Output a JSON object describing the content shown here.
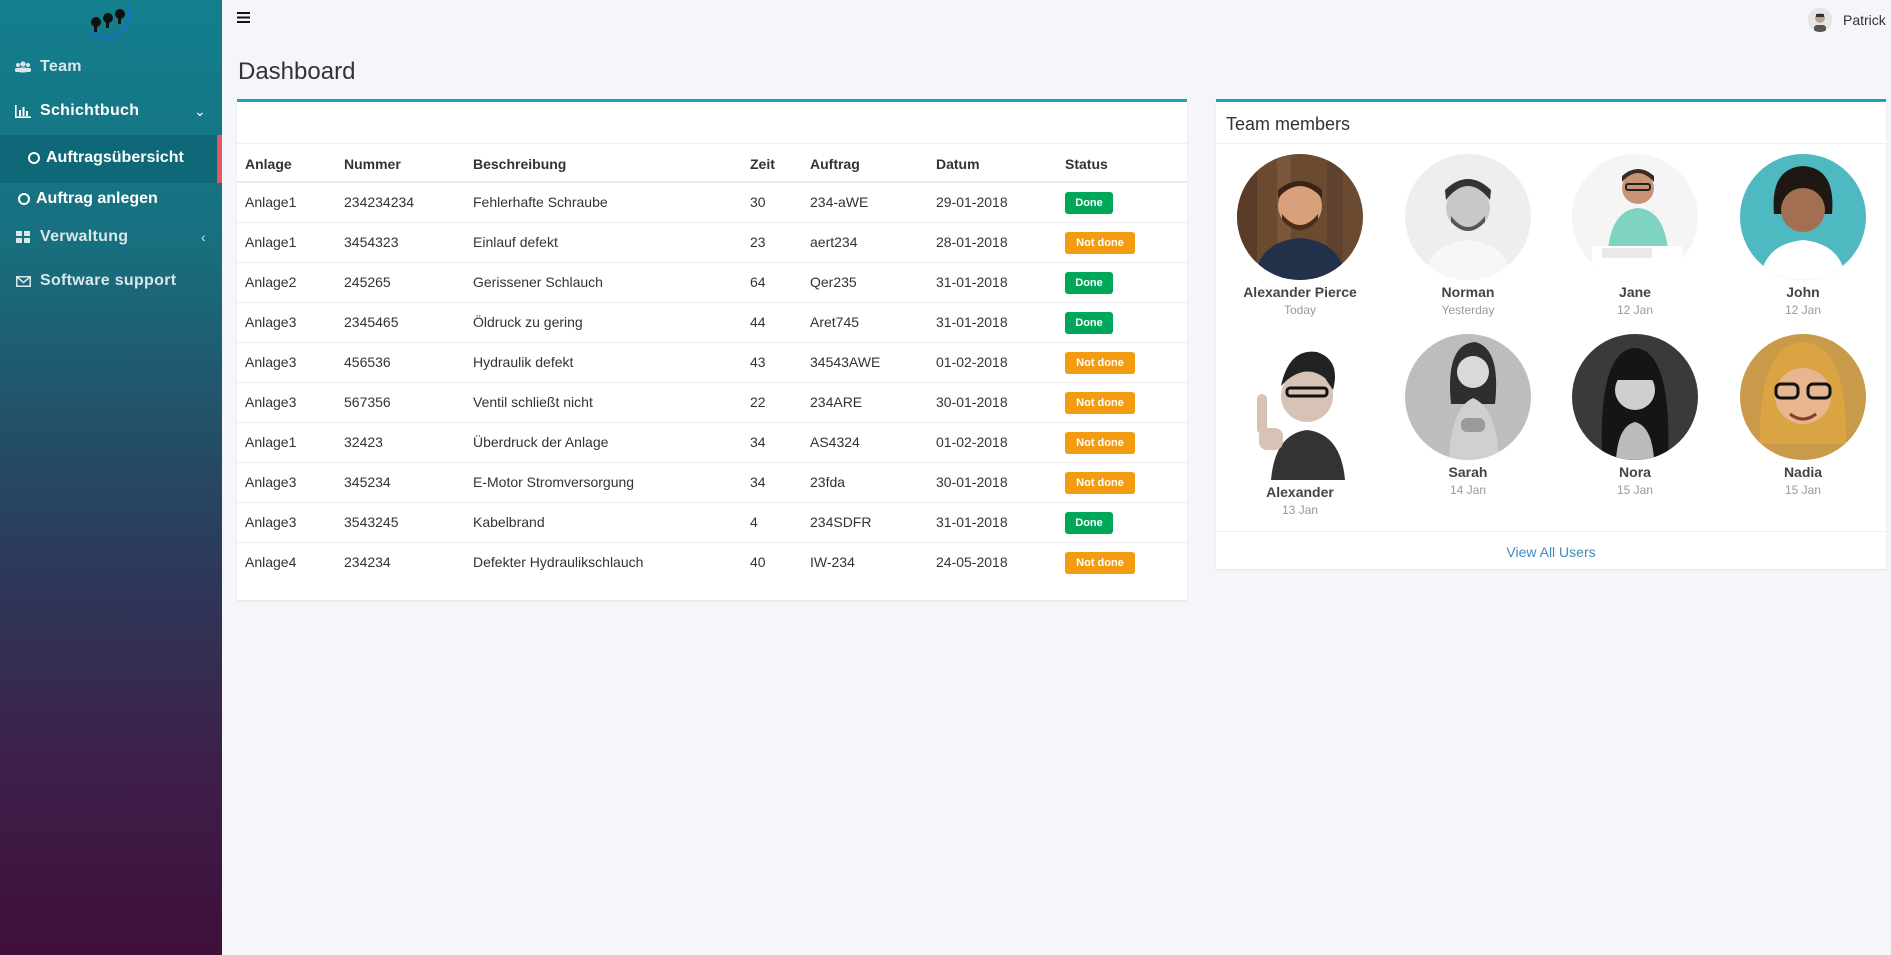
{
  "sidebar": {
    "items": [
      {
        "label": "Team",
        "icon": "users-icon"
      },
      {
        "label": "Schichtbuch",
        "icon": "bar-chart-icon"
      },
      {
        "label": "Auftragsübersicht",
        "icon": "circle-icon"
      },
      {
        "label": "Auftrag anlegen",
        "icon": "circle-icon"
      },
      {
        "label": "Verwaltung",
        "icon": "dashboard-icon"
      },
      {
        "label": "Software support",
        "icon": "envelope-icon"
      }
    ],
    "accent": "#e05a66"
  },
  "topbar": {
    "user": "Patrick"
  },
  "page": {
    "title": "Dashboard"
  },
  "table": {
    "headers": [
      "Anlage",
      "Nummer",
      "Beschreibung",
      "Zeit",
      "Auftrag",
      "Datum",
      "Status"
    ],
    "rows": [
      {
        "anlage": "Anlage1",
        "nummer": "234234234",
        "beschreibung": "Fehlerhafte Schraube",
        "zeit": "30",
        "auftrag": "234-aWE",
        "datum": "29-01-2018",
        "status": "Done"
      },
      {
        "anlage": "Anlage1",
        "nummer": "3454323",
        "beschreibung": "Einlauf defekt",
        "zeit": "23",
        "auftrag": "aert234",
        "datum": "28-01-2018",
        "status": "Not done"
      },
      {
        "anlage": "Anlage2",
        "nummer": "245265",
        "beschreibung": "Gerissener Schlauch",
        "zeit": "64",
        "auftrag": "Qer235",
        "datum": "31-01-2018",
        "status": "Done"
      },
      {
        "anlage": "Anlage3",
        "nummer": "2345465",
        "beschreibung": "Öldruck zu gering",
        "zeit": "44",
        "auftrag": "Aret745",
        "datum": "31-01-2018",
        "status": "Done"
      },
      {
        "anlage": "Anlage3",
        "nummer": "456536",
        "beschreibung": "Hydraulik defekt",
        "zeit": "43",
        "auftrag": "34543AWE",
        "datum": "01-02-2018",
        "status": "Not done"
      },
      {
        "anlage": "Anlage3",
        "nummer": "567356",
        "beschreibung": "Ventil schließt nicht",
        "zeit": "22",
        "auftrag": "234ARE",
        "datum": "30-01-2018",
        "status": "Not done"
      },
      {
        "anlage": "Anlage1",
        "nummer": "32423",
        "beschreibung": "Überdruck der Anlage",
        "zeit": "34",
        "auftrag": "AS4324",
        "datum": "01-02-2018",
        "status": "Not done"
      },
      {
        "anlage": "Anlage3",
        "nummer": "345234",
        "beschreibung": "E-Motor Stromversorgung",
        "zeit": "34",
        "auftrag": "23fda",
        "datum": "30-01-2018",
        "status": "Not done"
      },
      {
        "anlage": "Anlage3",
        "nummer": "3543245",
        "beschreibung": "Kabelbrand",
        "zeit": "4",
        "auftrag": "234SDFR",
        "datum": "31-01-2018",
        "status": "Done"
      },
      {
        "anlage": "Anlage4",
        "nummer": "234234",
        "beschreibung": "Defekter Hydraulikschlauch",
        "zeit": "40",
        "auftrag": "IW-234",
        "datum": "24-05-2018",
        "status": "Not done"
      }
    ],
    "colors": {
      "done": "#00a65a",
      "not_done": "#f39c12",
      "accent": "#17a2b8"
    }
  },
  "team": {
    "title": "Team members",
    "members": [
      {
        "name": "Alexander Pierce",
        "date": "Today"
      },
      {
        "name": "Norman",
        "date": "Yesterday"
      },
      {
        "name": "Jane",
        "date": "12 Jan"
      },
      {
        "name": "John",
        "date": "12 Jan"
      },
      {
        "name": "Alexander",
        "date": "13 Jan"
      },
      {
        "name": "Sarah",
        "date": "14 Jan"
      },
      {
        "name": "Nora",
        "date": "15 Jan"
      },
      {
        "name": "Nadia",
        "date": "15 Jan"
      }
    ],
    "view_all": "View All Users"
  }
}
